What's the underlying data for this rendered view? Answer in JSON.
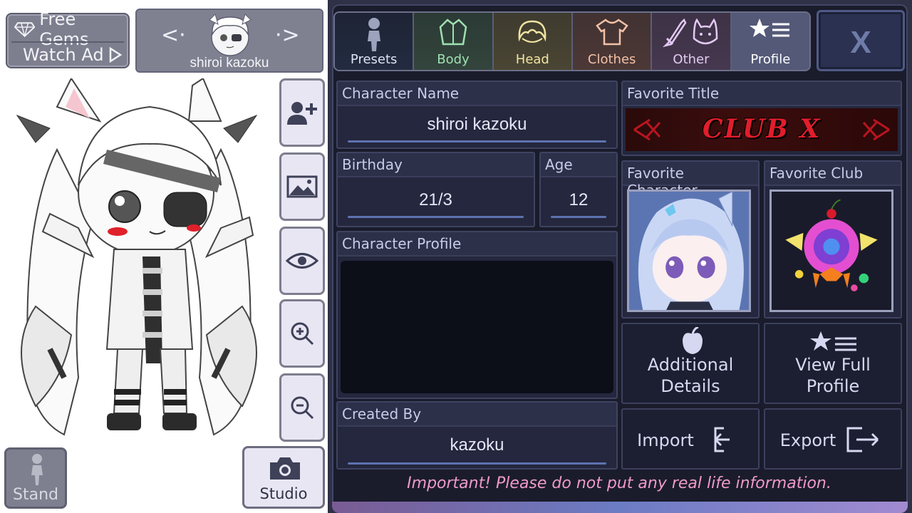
{
  "top_left": {
    "free_gems_label": "Free Gems",
    "watch_ad_label": "Watch Ad"
  },
  "character_select": {
    "name": "shiroi kazoku",
    "prev_arrow": "<·",
    "next_arrow": "·>"
  },
  "left_buttons": {
    "stand_label": "Stand",
    "studio_label": "Studio",
    "icons": [
      "add-character-icon",
      "background-icon",
      "eye-icon",
      "zoom-in-icon",
      "zoom-out-icon"
    ]
  },
  "tabs": [
    {
      "label": "Presets",
      "color": "#dfe2f5"
    },
    {
      "label": "Body",
      "color": "#9fe0b0"
    },
    {
      "label": "Head",
      "color": "#f0e3a2"
    },
    {
      "label": "Clothes",
      "color": "#f3c1a6"
    },
    {
      "label": "Other",
      "color": "#e3c9f2"
    },
    {
      "label": "Profile",
      "color": "#ffffff"
    }
  ],
  "close_label": "X",
  "profile": {
    "name_label": "Character Name",
    "name_value": "shiroi kazoku",
    "birthday_label": "Birthday",
    "birthday_value": "21/3",
    "age_label": "Age",
    "age_value": "12",
    "profile_label": "Character Profile",
    "profile_value": "",
    "created_by_label": "Created By",
    "created_by_value": "kazoku",
    "favorite_title_label": "Favorite Title",
    "favorite_title_value": "CLUB X",
    "favorite_character_label": "Favorite Character",
    "favorite_club_label": "Favorite Club"
  },
  "actions": {
    "additional_details": "Additional Details",
    "view_full_profile": "View Full Profile",
    "import": "Import",
    "export": "Export"
  },
  "notice": "Important! Please do not put any real life information.",
  "colors": {
    "panel_bg": "#1a1c2c",
    "accent_line": "#5d72b0",
    "notice_pink": "#ef9ac8",
    "title_red": "#e11d2c"
  }
}
